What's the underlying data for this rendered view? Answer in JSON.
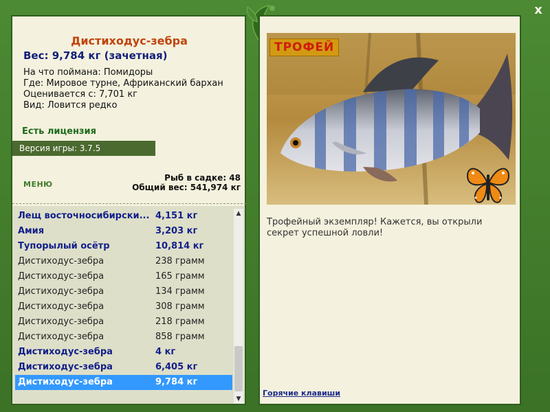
{
  "left": {
    "fish_name": "Дистиходус-зебра",
    "weight_line": "Вес: 9,784 кг (зачетная)",
    "caught_on": "На что поймана: Помидоры",
    "location": "Где: Мировое турне, Африканский бархан",
    "rated_from": "Оценивается с: 7,701 кг",
    "species": "Вид: Ловится редко",
    "license": "Есть лицензия",
    "version": "Версия игры: 3.7.5",
    "menu_label": "МЕНЮ",
    "fish_in_keepnet": "Рыб в садке: 48",
    "total_weight": "Общий вес: 541,974 кг"
  },
  "catch_list": [
    {
      "name": "Лещ восточносибирски...",
      "weight": "4,151 кг",
      "trophy": true
    },
    {
      "name": "Амия",
      "weight": "3,203 кг",
      "trophy": true
    },
    {
      "name": "Тупорылый осётр",
      "weight": "10,814 кг",
      "trophy": true
    },
    {
      "name": "Дистиходус-зебра",
      "weight": "238 грамм",
      "trophy": false
    },
    {
      "name": "Дистиходус-зебра",
      "weight": "165 грамм",
      "trophy": false
    },
    {
      "name": "Дистиходус-зебра",
      "weight": "134 грамм",
      "trophy": false
    },
    {
      "name": "Дистиходус-зебра",
      "weight": "308 грамм",
      "trophy": false
    },
    {
      "name": "Дистиходус-зебра",
      "weight": "218 грамм",
      "trophy": false
    },
    {
      "name": "Дистиходус-зебра",
      "weight": "858 грамм",
      "trophy": false
    },
    {
      "name": "Дистиходус-зебра",
      "weight": "4 кг",
      "trophy": true
    },
    {
      "name": "Дистиходус-зебра",
      "weight": "6,405 кг",
      "trophy": true
    },
    {
      "name": "Дистиходус-зебра",
      "weight": "9,784 кг",
      "trophy": true,
      "selected": true
    }
  ],
  "right": {
    "badge": "ТРОФЕЙ",
    "caption": "Трофейный экземпляр! Кажется, вы открыли секрет успешной ловли!",
    "hotkeys": "Горячие клавиши"
  },
  "window": {
    "close_symbol": "x"
  },
  "colors": {
    "frame_green": "#3f7a2a",
    "panel_bg": "#f4f1de",
    "title_orange": "#c0440c",
    "trophy_blue": "#12208a",
    "selection_blue": "#3399ff"
  },
  "icons": [
    "ornament-leaf-icon",
    "close-icon",
    "scroll-up-icon",
    "scroll-down-icon",
    "butterfly-icon"
  ]
}
